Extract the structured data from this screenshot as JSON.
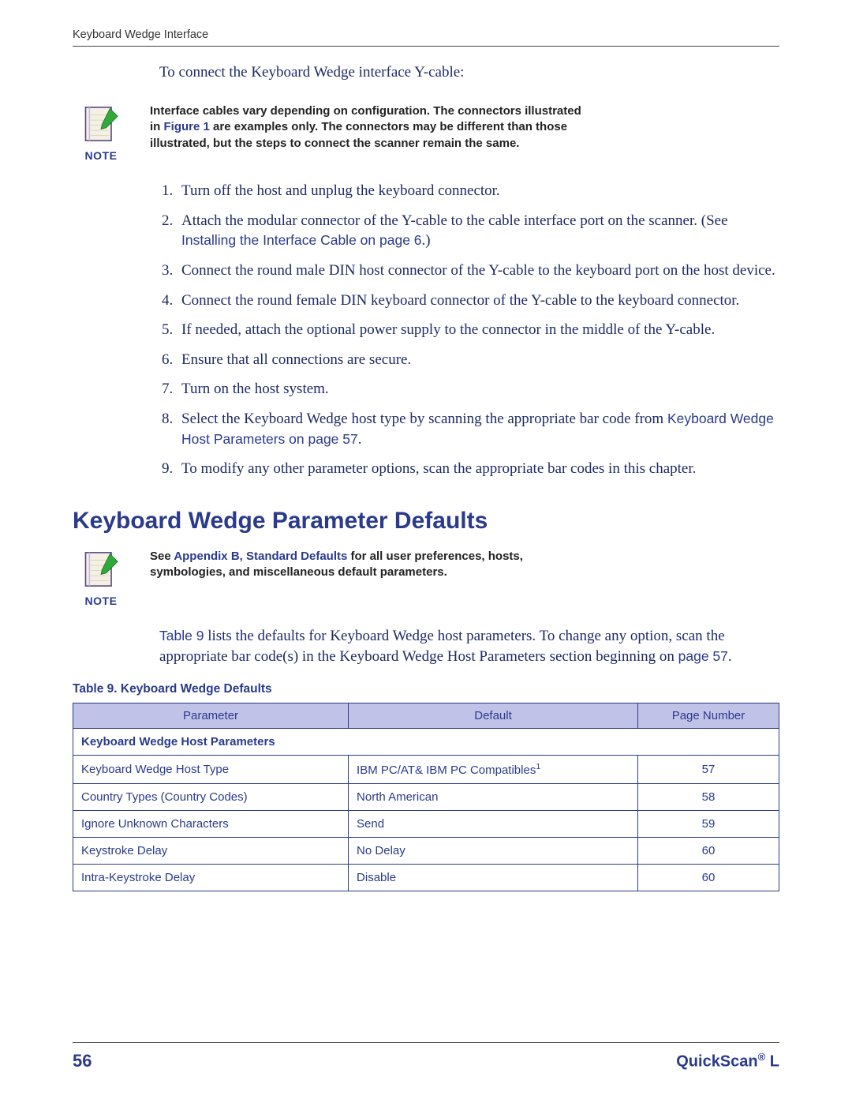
{
  "running_head": "Keyboard Wedge Interface",
  "intro": "To connect the Keyboard Wedge interface Y-cable:",
  "note1": {
    "label": "NOTE",
    "text_a": "Interface cables vary depending on configuration. The connectors illustrated in ",
    "text_link": "Figure 1",
    "text_b": " are examples only. The connectors may be different than those illustrated, but the steps to connect the scanner remain the same."
  },
  "steps": {
    "s1": "Turn off the host and unplug the keyboard connector.",
    "s2a": "Attach the modular connector of the Y-cable to the cable interface port on the scanner. (See ",
    "s2_link": "Installing the Interface Cable on page 6",
    "s2b": ".)",
    "s3": "Connect the round male DIN host connector of the Y-cable to the keyboard port on the host device.",
    "s4": "Connect the round female DIN keyboard connector of the Y-cable to the keyboard connector.",
    "s5": "If needed, attach the optional power supply to the connector in the middle of the Y-cable.",
    "s6": "Ensure that all connections are secure.",
    "s7": "Turn on the host system.",
    "s8a": "Select the Keyboard Wedge host type by scanning the appropriate bar code from ",
    "s8_link": "Keyboard Wedge Host Parameters on page 57",
    "s8b": ".",
    "s9": "To modify any other parameter options, scan the appropriate bar codes in this chapter."
  },
  "section_heading": "Keyboard Wedge Parameter Defaults",
  "note2": {
    "label": "NOTE",
    "text_a": "See ",
    "text_link": "Appendix B, Standard Defaults",
    "text_b": " for all user preferences, hosts, symbologies, and miscellaneous default parameters."
  },
  "body_para": {
    "a": "",
    "link1": "Table 9",
    "b": " lists the defaults for Keyboard Wedge host parameters. To change any option, scan the appropriate bar code(s) in the Keyboard Wedge Host Parameters section beginning on ",
    "link2": "page 57",
    "c": "."
  },
  "table_caption": "Table 9. Keyboard Wedge Defaults",
  "table": {
    "headers": {
      "c1": "Parameter",
      "c2": "Default",
      "c3": "Page Number"
    },
    "section_row": "Keyboard Wedge Host Parameters",
    "rows": [
      {
        "param": "Keyboard Wedge Host Type",
        "def": "IBM PC/AT& IBM PC Compatibles",
        "def_sup": "1",
        "page": "57"
      },
      {
        "param": "Country Types (Country Codes)",
        "def": "North American",
        "def_sup": "",
        "page": "58"
      },
      {
        "param": "Ignore Unknown Characters",
        "def": "Send",
        "def_sup": "",
        "page": "59"
      },
      {
        "param": "Keystroke Delay",
        "def": "No Delay",
        "def_sup": "",
        "page": "60"
      },
      {
        "param": "Intra-Keystroke Delay",
        "def": "Disable",
        "def_sup": "",
        "page": "60"
      }
    ]
  },
  "footer": {
    "page_number": "56",
    "product_a": "QuickScan",
    "product_reg": "®",
    "product_b": " L"
  }
}
